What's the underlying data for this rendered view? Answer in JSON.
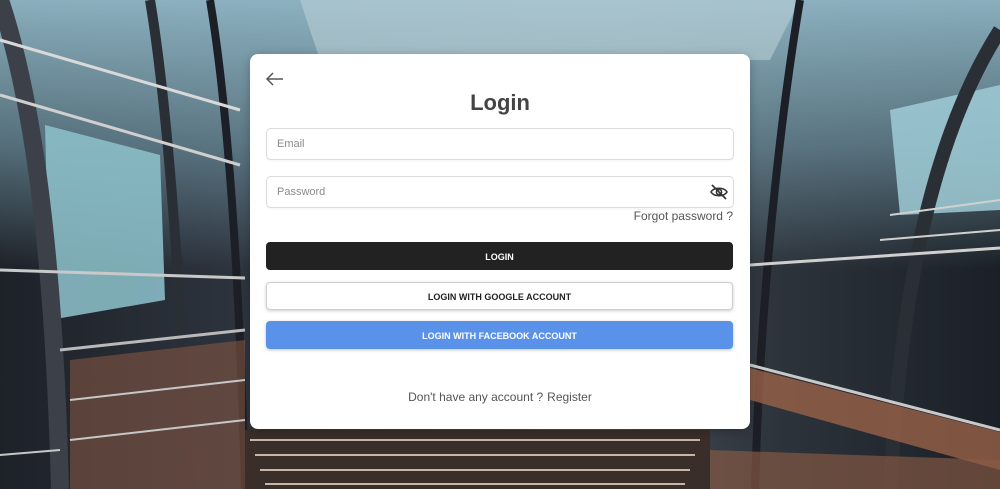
{
  "page": {
    "title": "Login"
  },
  "form": {
    "email_placeholder": "Email",
    "email_value": "",
    "password_placeholder": "Password",
    "password_value": "",
    "forgot_password": "Forgot password ?"
  },
  "buttons": {
    "login": "LOGIN",
    "google": "LOGIN WITH GOOGLE ACCOUNT",
    "facebook": "LOGIN WITH FACEBOOK ACCOUNT"
  },
  "footer": {
    "prompt": "Don't have any account ?",
    "register_link": "Register"
  },
  "icons": {
    "back": "arrow-left-icon",
    "password_toggle": "eye-off-icon"
  },
  "colors": {
    "login_button": "#222222",
    "facebook_button": "#5b92e9",
    "card": "#ffffff"
  }
}
